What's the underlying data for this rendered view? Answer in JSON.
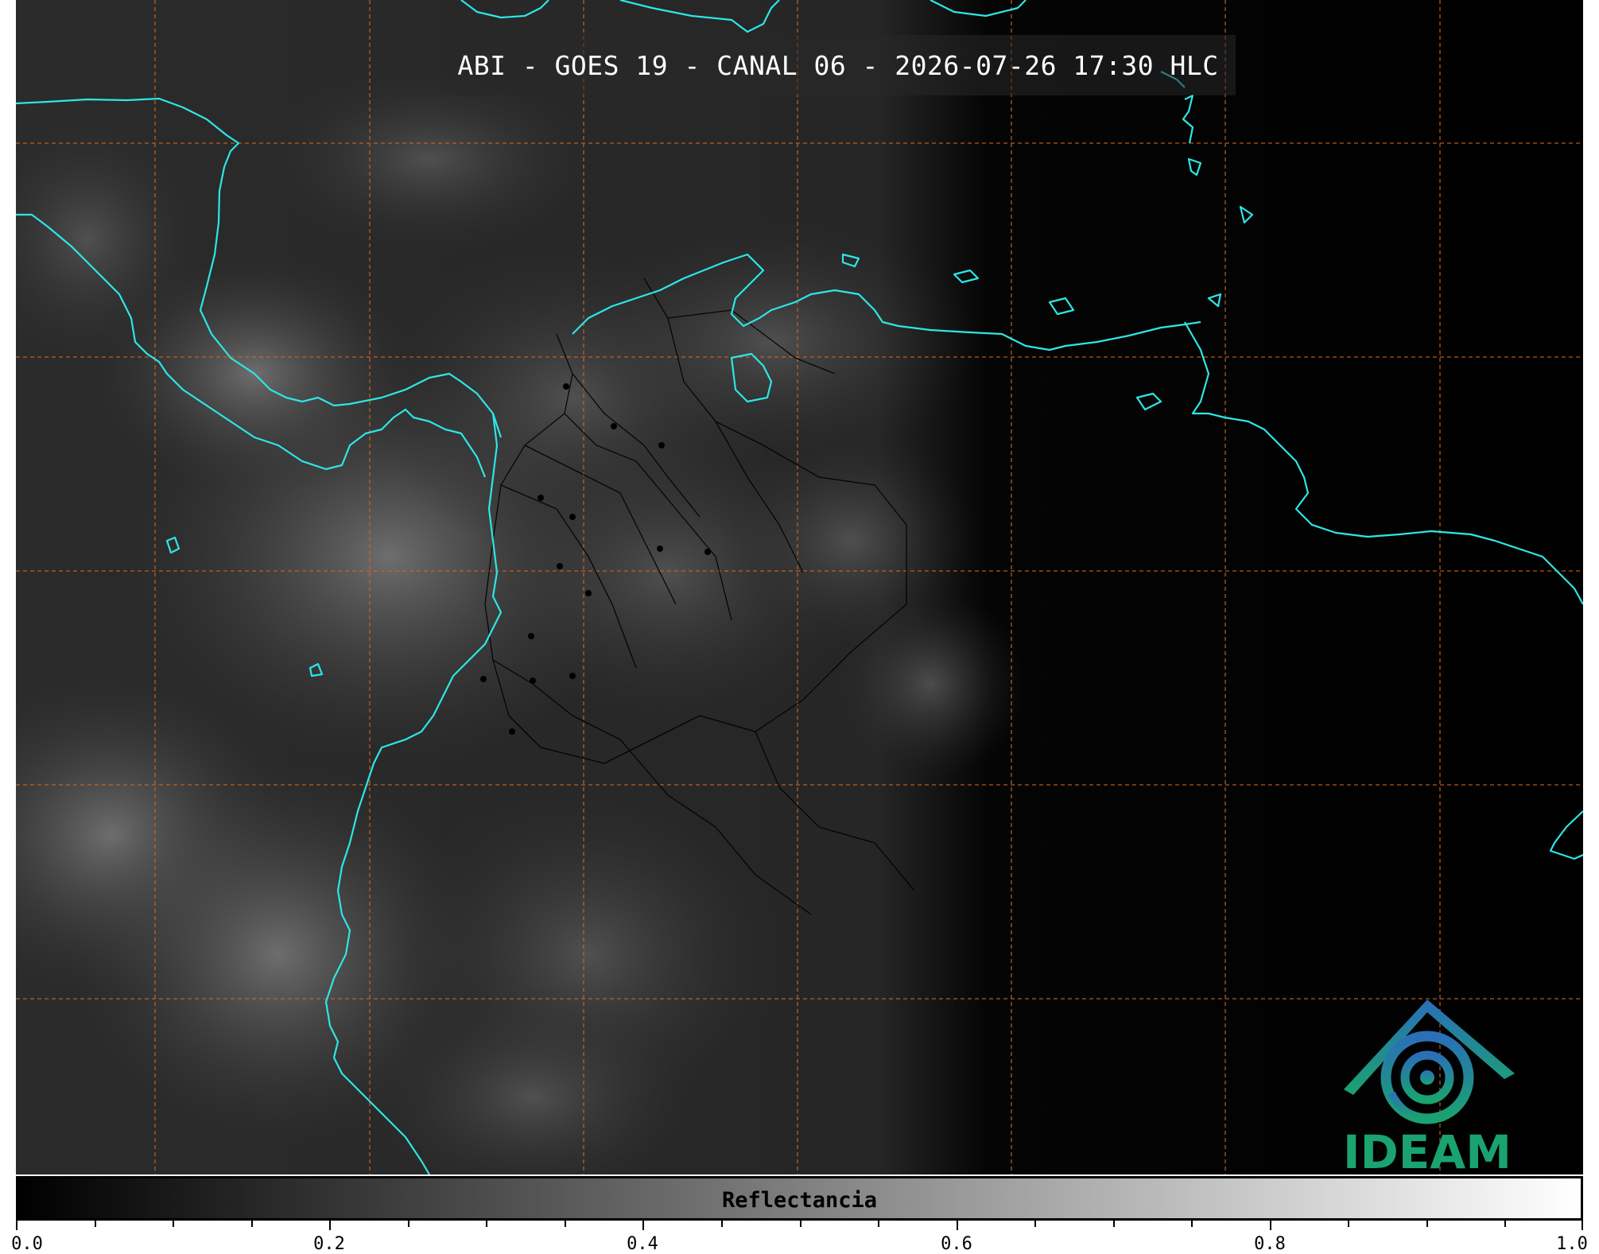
{
  "title": "ABI - GOES 19 - CANAL 06 - 2026-07-26 17:30 HLC",
  "logo": {
    "text": "IDEAM",
    "icon": "ideam-spiral-logo",
    "color": "#1aa36f"
  },
  "colorbar": {
    "label": "Reflectancia",
    "min": 0.0,
    "max": 1.0,
    "colormap": "greys",
    "tick_labels": [
      "0.0",
      "0.2",
      "0.4",
      "0.6",
      "0.8",
      "1.0"
    ],
    "minor_ticks": 20
  },
  "map": {
    "coastline_color": "#2ee6e6",
    "border_color": "#000000",
    "grid_color": "#d2691e",
    "grid_style": "dashed"
  }
}
